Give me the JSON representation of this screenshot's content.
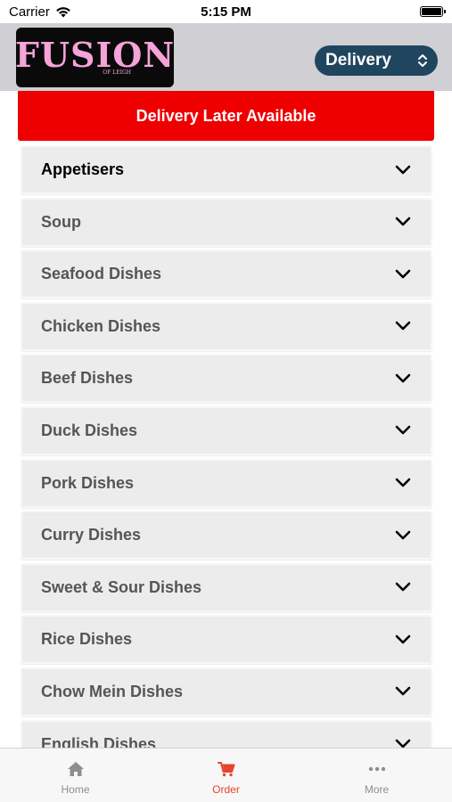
{
  "status_bar": {
    "carrier": "Carrier",
    "time": "5:15 PM"
  },
  "header": {
    "logo_text": "FUSION",
    "logo_subtext": "OF LEIGH",
    "mode_select_value": "Delivery"
  },
  "banner": {
    "text": "Delivery Later Available"
  },
  "menu": {
    "categories": [
      {
        "label": "Appetisers"
      },
      {
        "label": "Soup"
      },
      {
        "label": "Seafood Dishes"
      },
      {
        "label": "Chicken Dishes"
      },
      {
        "label": "Beef Dishes"
      },
      {
        "label": "Duck Dishes"
      },
      {
        "label": "Pork Dishes"
      },
      {
        "label": "Curry Dishes"
      },
      {
        "label": "Sweet & Sour Dishes"
      },
      {
        "label": "Rice Dishes"
      },
      {
        "label": "Chow Mein Dishes"
      },
      {
        "label": "English Dishes"
      }
    ]
  },
  "tab_bar": {
    "tabs": [
      {
        "label": "Home",
        "icon": "home-icon"
      },
      {
        "label": "Order",
        "icon": "cart-icon",
        "active": true
      },
      {
        "label": "More",
        "icon": "more-icon"
      }
    ]
  },
  "colors": {
    "banner": "#ee0000",
    "select_bg": "#20455e",
    "active_tab": "#e8432e",
    "logo_pink": "#f5a3d8"
  }
}
